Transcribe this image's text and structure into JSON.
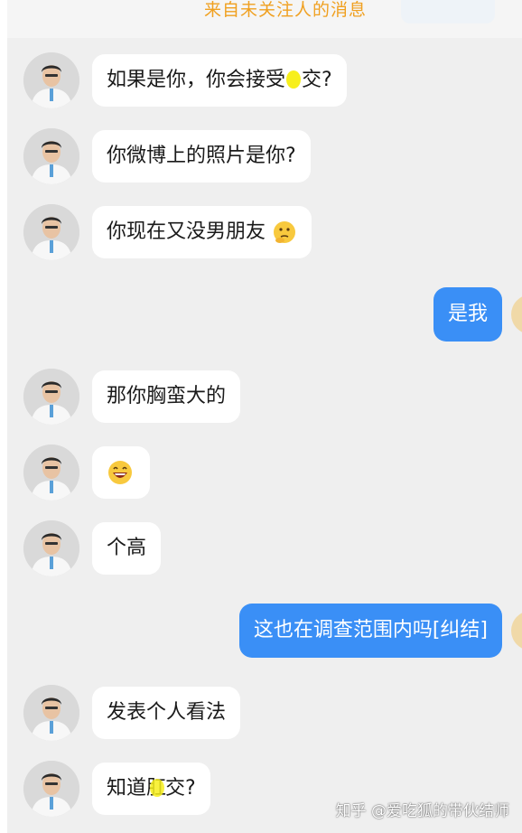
{
  "header": {
    "title": "来自未关注人的消息"
  },
  "messages": [
    {
      "side": "left",
      "parts": [
        "如果是你，你会接受",
        "交?"
      ]
    },
    {
      "side": "left",
      "text": "你微博上的照片是你?"
    },
    {
      "side": "left",
      "text": "你现在又没男朋友",
      "emoji": "thinking-face-emoji"
    },
    {
      "side": "right",
      "text": "是我"
    },
    {
      "side": "left",
      "text": "那你胸蛮大的"
    },
    {
      "side": "left",
      "emoji": "laughing-face-emoji"
    },
    {
      "side": "left",
      "text": "个高"
    },
    {
      "side": "right",
      "text": "这也在调查范围内吗[纠结]"
    },
    {
      "side": "left",
      "text": "发表个人看法"
    },
    {
      "side": "left",
      "parts": [
        "知道肛",
        "交?"
      ]
    }
  ],
  "watermark": "知乎 @爱吃狐的带伙结师",
  "colors": {
    "header_text": "#f0a020",
    "incoming_bubble": "#ffffff",
    "outgoing_bubble": "#3a8ff6",
    "censor_mark": "#f7ef1c"
  }
}
